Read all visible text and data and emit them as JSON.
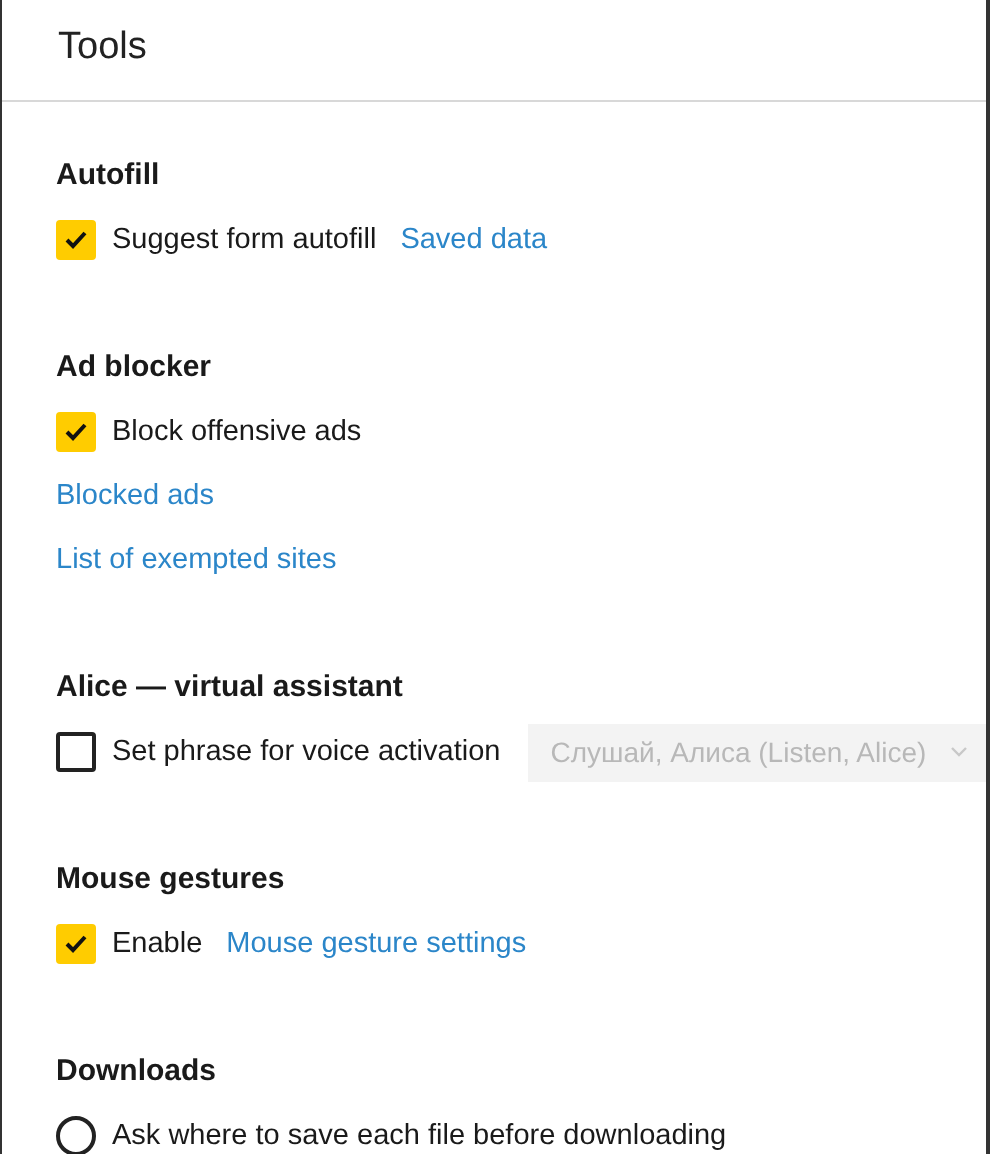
{
  "window": {
    "title": "Tools"
  },
  "sections": [
    {
      "heading": "Autofill",
      "items": [
        {
          "kind": "checkbox",
          "label": "Suggest form autofill",
          "checked": true,
          "link": "Saved data"
        }
      ]
    },
    {
      "heading": "Ad blocker",
      "items": [
        {
          "kind": "checkbox",
          "label": "Block offensive ads",
          "checked": true
        },
        {
          "kind": "link",
          "label": "Blocked ads"
        },
        {
          "kind": "link",
          "label": "List of exempted sites"
        }
      ]
    },
    {
      "heading": "Alice — virtual assistant",
      "items": [
        {
          "kind": "checkbox",
          "label": "Set phrase for voice activation",
          "checked": false,
          "select": {
            "value": "Слушай, Алиса (Listen, Alice)",
            "disabled": true
          }
        }
      ]
    },
    {
      "heading": "Mouse gestures",
      "items": [
        {
          "kind": "checkbox",
          "label": "Enable",
          "checked": true,
          "link": "Mouse gesture settings"
        }
      ]
    },
    {
      "heading": "Downloads",
      "items": [
        {
          "kind": "radio",
          "label": "Ask where to save each file before downloading",
          "selected": false
        }
      ]
    }
  ]
}
